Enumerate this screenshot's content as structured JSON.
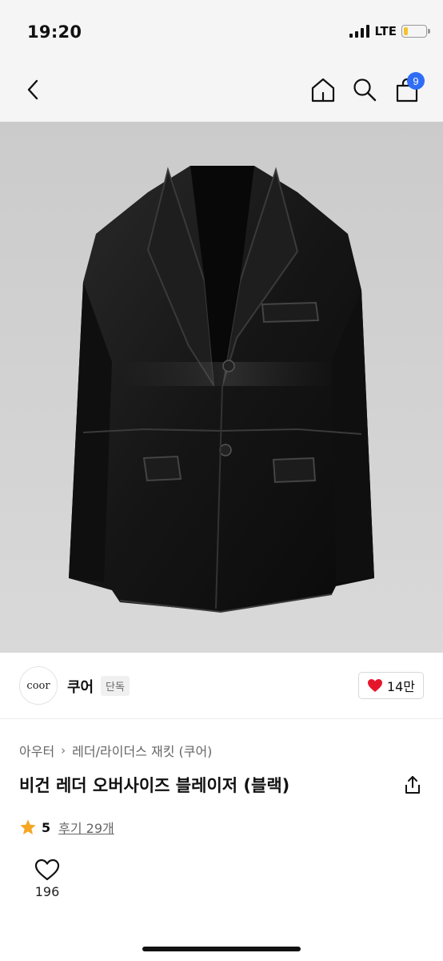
{
  "status_bar": {
    "time": "19:20",
    "network": "LTE",
    "battery_level": 0.2,
    "battery_color": "#f2c230"
  },
  "nav": {
    "back_icon": "chevron-left-icon",
    "home_icon": "home-icon",
    "search_icon": "search-icon",
    "cart_icon": "shopping-bag-icon",
    "cart_count": "9",
    "badge_color": "#2f6df6"
  },
  "hero": {
    "image_subject": "black leather blazer"
  },
  "seller": {
    "logo_text": "coor",
    "name": "쿠어",
    "badge": "단독",
    "likes": "14만",
    "like_color": "#e5162b"
  },
  "product": {
    "breadcrumb": [
      "아우터",
      "레더/라이더스 재킷 (쿠어)"
    ],
    "title": "비건 레더 오버사이즈 블레이저 (블랙)",
    "rating": "5",
    "reviews_label": "후기 29개",
    "star_color": "#f5a623"
  },
  "wishlist": {
    "count": "196"
  }
}
